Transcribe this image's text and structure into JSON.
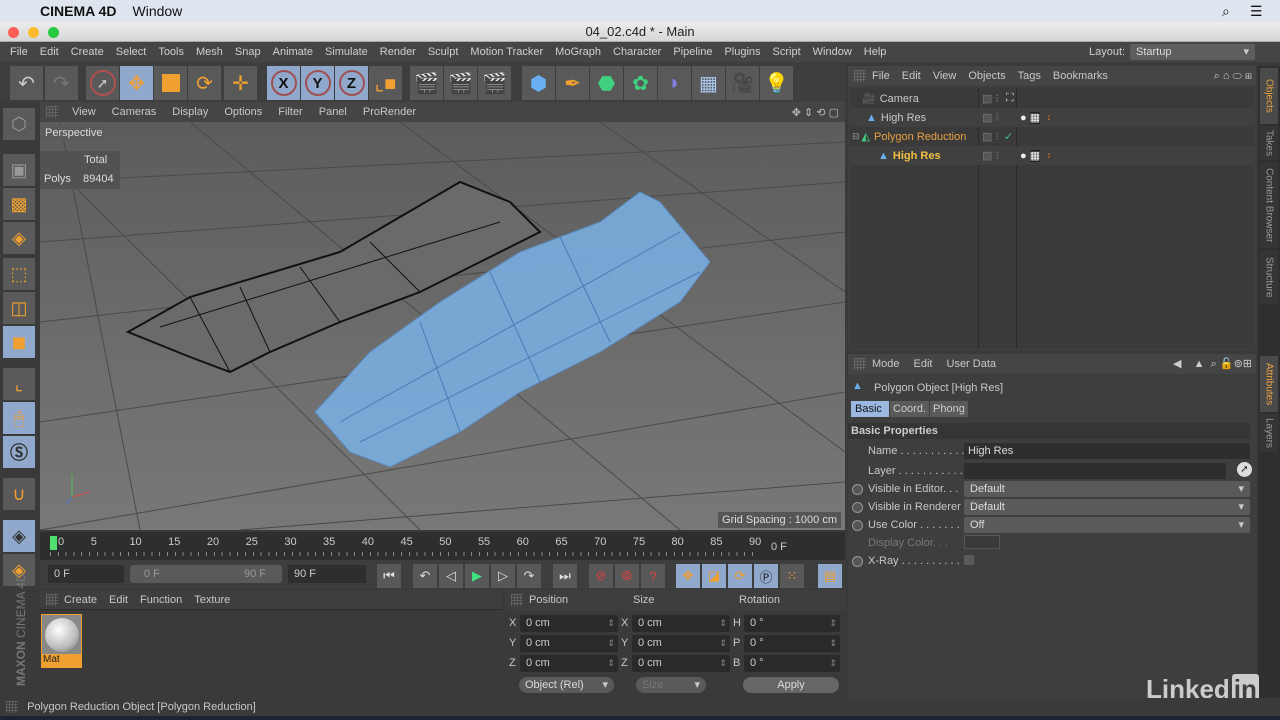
{
  "mac_menubar": {
    "apple": "",
    "app_name": "CINEMA 4D",
    "window_menu": "Window"
  },
  "window": {
    "title": "04_02.c4d * - Main"
  },
  "main_menu": [
    "File",
    "Edit",
    "Create",
    "Select",
    "Tools",
    "Mesh",
    "Snap",
    "Animate",
    "Simulate",
    "Render",
    "Sculpt",
    "Motion Tracker",
    "MoGraph",
    "Character",
    "Pipeline",
    "Plugins",
    "Script",
    "Window",
    "Help"
  ],
  "layout": {
    "label": "Layout:",
    "value": "Startup"
  },
  "toolbar": {
    "undo": "↶",
    "redo": "↷",
    "tools": [
      {
        "name": "live-selection",
        "glyph": "➚",
        "selected": false
      },
      {
        "name": "move",
        "glyph": "✥",
        "selected": true
      },
      {
        "name": "scale",
        "glyph": "◪",
        "selected": false
      },
      {
        "name": "rotate",
        "glyph": "⟳",
        "selected": false
      },
      {
        "name": "recent-tool",
        "glyph": "✛",
        "selected": false
      }
    ],
    "axes": [
      "X",
      "Y",
      "Z"
    ],
    "coord_system": "⌞",
    "render": [
      "render-view",
      "render-picture-viewer",
      "render-settings"
    ],
    "create": [
      "cube",
      "pen",
      "subdivision-surface",
      "cloner",
      "deformer",
      "floor",
      "camera",
      "light"
    ]
  },
  "viewport": {
    "menu": [
      "View",
      "Cameras",
      "Display",
      "Options",
      "Filter",
      "Panel",
      "ProRender"
    ],
    "camera_label": "Perspective",
    "stats": {
      "header": "Total",
      "label": "Polys",
      "value": "89404"
    },
    "grid_spacing": "Grid Spacing : 1000 cm"
  },
  "timeline": {
    "ticks": [
      "0",
      "5",
      "10",
      "15",
      "20",
      "25",
      "30",
      "35",
      "40",
      "45",
      "50",
      "55",
      "60",
      "65",
      "70",
      "75",
      "80",
      "85",
      "90"
    ],
    "current_frame": "0 F",
    "start_field": "0 F",
    "range_start": "0 F",
    "range_end": "90 F",
    "end_field": "90 F",
    "current_frame_display": "0 F"
  },
  "material_manager": {
    "menu": [
      "Create",
      "Edit",
      "Function",
      "Texture"
    ],
    "materials": [
      {
        "name": "Mat"
      }
    ]
  },
  "coordinates": {
    "headers": [
      "Position",
      "Size",
      "Rotation"
    ],
    "position": [
      {
        "axis": "X",
        "value": "0 cm"
      },
      {
        "axis": "Y",
        "value": "0 cm"
      },
      {
        "axis": "Z",
        "value": "0 cm"
      }
    ],
    "size": [
      {
        "axis": "X",
        "value": "0 cm"
      },
      {
        "axis": "Y",
        "value": "0 cm"
      },
      {
        "axis": "Z",
        "value": "0 cm"
      }
    ],
    "rotation": [
      {
        "axis": "H",
        "value": "0 °"
      },
      {
        "axis": "P",
        "value": "0 °"
      },
      {
        "axis": "B",
        "value": "0 °"
      }
    ],
    "mode": "Object (Rel)",
    "size_mode": "Size",
    "apply": "Apply"
  },
  "object_manager": {
    "menu": [
      "File",
      "Edit",
      "View",
      "Objects",
      "Tags",
      "Bookmarks"
    ],
    "objects": [
      {
        "name": "Camera",
        "type": "camera",
        "color": "#c8c8c8"
      },
      {
        "name": "High Res",
        "type": "polygon",
        "color": "#c8c8c8"
      },
      {
        "name": "Polygon Reduction",
        "type": "generator",
        "color": "#e8a040"
      },
      {
        "name": "High Res",
        "type": "polygon",
        "color": "#f0c040"
      }
    ]
  },
  "attributes": {
    "menu": [
      "Mode",
      "Edit",
      "User Data"
    ],
    "object_title": "Polygon Object [High Res]",
    "tabs": [
      {
        "label": "Basic",
        "active": true
      },
      {
        "label": "Coord.",
        "active": false
      },
      {
        "label": "Phong",
        "active": false
      }
    ],
    "section": "Basic Properties",
    "fields": [
      {
        "label": "Name . . . . . . . . . . .",
        "value": "High Res"
      },
      {
        "label": "Layer . . . . . . . . . . .",
        "value": ""
      },
      {
        "label": "Visible in Editor. . .",
        "value": "Default"
      },
      {
        "label": "Visible in Renderer",
        "value": "Default"
      },
      {
        "label": "Use Color . . . . . . .",
        "value": "Off"
      },
      {
        "label": "Display Color. . .",
        "value": ""
      },
      {
        "label": "X-Ray . . . . . . . . . .",
        "value": ""
      }
    ]
  },
  "side_tabs": {
    "top": [
      "Objects",
      "Takes",
      "Content Browser",
      "Structure"
    ],
    "bottom": [
      "Attributes",
      "Layers"
    ]
  },
  "branding": {
    "maxon": "MAXON",
    "cinema": "CINEMA 4D",
    "linkedin": "Linked",
    "in": "in"
  },
  "status_bar": "Polygon Reduction Object [Polygon Reduction]"
}
